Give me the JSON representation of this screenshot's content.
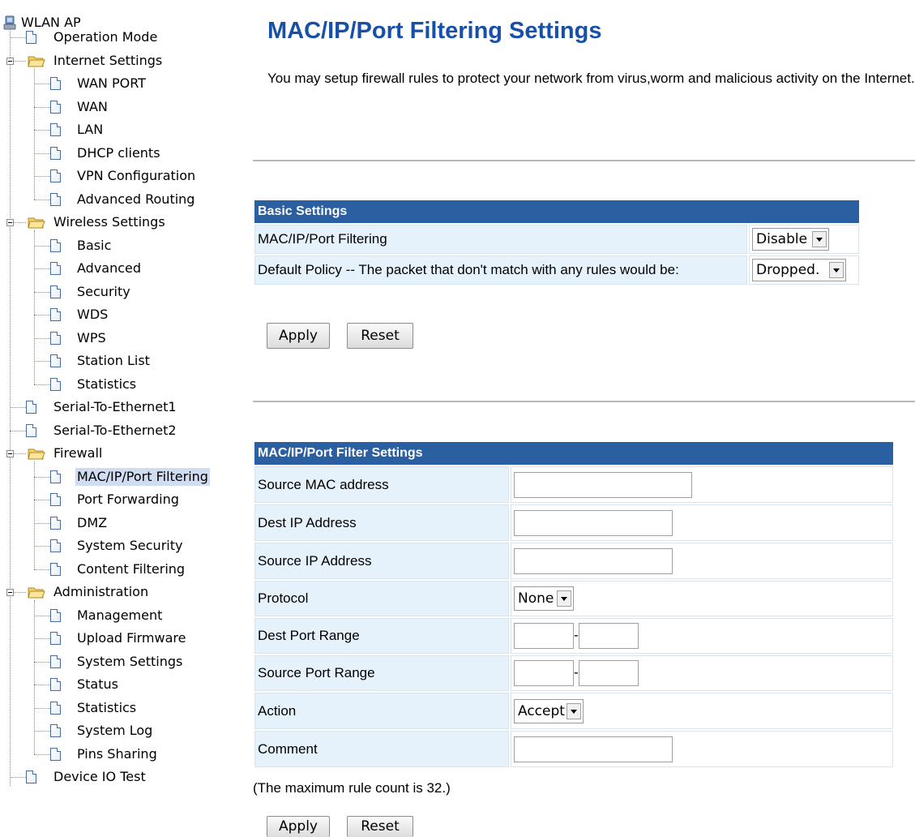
{
  "sidebar": {
    "root": "WLAN AP",
    "items": [
      {
        "label": "Operation Mode"
      },
      {
        "label": "Internet Settings"
      },
      {
        "label": "WAN PORT"
      },
      {
        "label": "WAN"
      },
      {
        "label": "LAN"
      },
      {
        "label": "DHCP clients"
      },
      {
        "label": "VPN Configuration"
      },
      {
        "label": "Advanced Routing"
      },
      {
        "label": "Wireless Settings"
      },
      {
        "label": "Basic"
      },
      {
        "label": "Advanced"
      },
      {
        "label": "Security"
      },
      {
        "label": "WDS"
      },
      {
        "label": "WPS"
      },
      {
        "label": "Station List"
      },
      {
        "label": "Statistics"
      },
      {
        "label": "Serial-To-Ethernet1"
      },
      {
        "label": "Serial-To-Ethernet2"
      },
      {
        "label": "Firewall"
      },
      {
        "label": "MAC/IP/Port Filtering"
      },
      {
        "label": "Port Forwarding"
      },
      {
        "label": "DMZ"
      },
      {
        "label": "System Security"
      },
      {
        "label": "Content Filtering"
      },
      {
        "label": "Administration"
      },
      {
        "label": "Management"
      },
      {
        "label": "Upload Firmware"
      },
      {
        "label": "System Settings"
      },
      {
        "label": "Status"
      },
      {
        "label": "Statistics"
      },
      {
        "label": "System Log"
      },
      {
        "label": "Pins Sharing"
      },
      {
        "label": "Device IO Test"
      }
    ]
  },
  "page": {
    "title": "MAC/IP/Port Filtering Settings",
    "intro": "You may setup firewall rules to protect your network from virus,worm and malicious activity on the Internet."
  },
  "basic": {
    "header": "Basic Settings",
    "filtering_label": "MAC/IP/Port Filtering",
    "filtering_value": "Disable",
    "policy_label": "Default Policy -- The packet that don't match with any rules would be:",
    "policy_value": "Dropped.",
    "apply": "Apply",
    "reset": "Reset"
  },
  "filter": {
    "header": "MAC/IP/Port Filter Settings",
    "src_mac_label": "Source MAC address",
    "src_mac_value": "",
    "dest_ip_label": "Dest IP Address",
    "dest_ip_value": "",
    "src_ip_label": "Source IP Address",
    "src_ip_value": "",
    "protocol_label": "Protocol",
    "protocol_value": "None",
    "dest_port_label": "Dest Port Range",
    "src_port_label": "Source Port Range",
    "range_sep": "-",
    "action_label": "Action",
    "action_value": "Accept",
    "comment_label": "Comment",
    "comment_value": "",
    "note": "(The maximum rule count is 32.)",
    "apply": "Apply",
    "reset": "Reset"
  },
  "colors": {
    "title": "#1750a8",
    "header_bg": "#2a5fa1",
    "label_bg": "#e6f2fb",
    "selected_bg": "#cfdcf2"
  }
}
